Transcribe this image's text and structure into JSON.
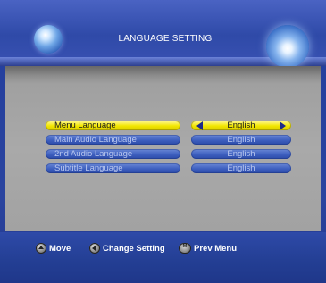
{
  "header": {
    "title": "LANGUAGE SETTING"
  },
  "menu": {
    "items": [
      {
        "label": "Menu Language",
        "value": "English",
        "selected": true
      },
      {
        "label": "Main Audio Language",
        "value": "English",
        "selected": false
      },
      {
        "label": "2nd Audio Language",
        "value": "English",
        "selected": false
      },
      {
        "label": "Subtitle Language",
        "value": "English",
        "selected": false
      }
    ]
  },
  "footer": {
    "move_label": "Move",
    "change_label": "Change Setting",
    "prev_label": "Prev Menu"
  },
  "colors": {
    "accent_yellow": "#f2e600",
    "pill_blue": "#3d5fbf",
    "background_blue": "#243f9e",
    "panel_gray": "#a9a9a9"
  },
  "icons": [
    "orb-decoration-icon",
    "updown-button-icon",
    "leftright-button-icon",
    "menu-button-icon",
    "arrow-left-icon",
    "arrow-right-icon"
  ]
}
